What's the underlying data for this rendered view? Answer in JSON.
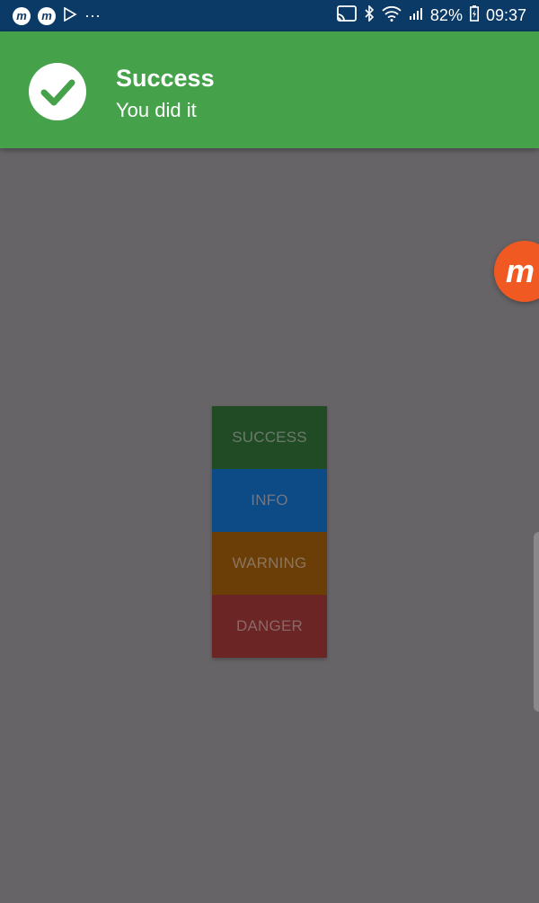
{
  "status_bar": {
    "left_icons": [
      "m",
      "m"
    ],
    "more": "···",
    "battery": "82%",
    "time": "09:37"
  },
  "toast": {
    "title": "Success",
    "message": "You did it",
    "color": "#45a24b"
  },
  "fab": {
    "label": "m",
    "color": "#f05a22"
  },
  "buttons": [
    {
      "label": "SUCCESS",
      "bg": "#214b24",
      "fg": "#6d7a6d"
    },
    {
      "label": "INFO",
      "bg": "#0c4b86",
      "fg": "#6f7787"
    },
    {
      "label": "WARNING",
      "bg": "#6a3e06",
      "fg": "#8b7560"
    },
    {
      "label": "DANGER",
      "bg": "#6a2524",
      "fg": "#8b6868"
    }
  ]
}
